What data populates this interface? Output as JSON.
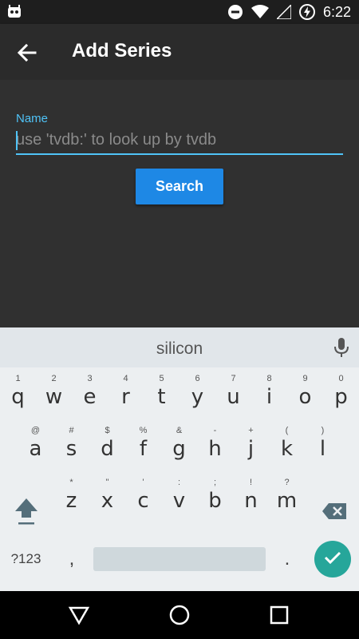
{
  "status_bar": {
    "time": "6:22",
    "icons": [
      "android-icon",
      "do-not-disturb-icon",
      "wifi-icon",
      "signal-icon",
      "battery-charging-icon"
    ]
  },
  "app_bar": {
    "title": "Add Series",
    "back_icon": "back-arrow-icon"
  },
  "form": {
    "name_label": "Name",
    "name_placeholder": "use 'tvdb:' to look up by tvdb",
    "name_value": "",
    "search_label": "Search"
  },
  "keyboard": {
    "suggestion": "silicon",
    "row1": [
      {
        "c": "q",
        "h": "1"
      },
      {
        "c": "w",
        "h": "2"
      },
      {
        "c": "e",
        "h": "3"
      },
      {
        "c": "r",
        "h": "4"
      },
      {
        "c": "t",
        "h": "5"
      },
      {
        "c": "y",
        "h": "6"
      },
      {
        "c": "u",
        "h": "7"
      },
      {
        "c": "i",
        "h": "8"
      },
      {
        "c": "o",
        "h": "9"
      },
      {
        "c": "p",
        "h": "0"
      }
    ],
    "row2": [
      {
        "c": "a",
        "h": "@"
      },
      {
        "c": "s",
        "h": "#"
      },
      {
        "c": "d",
        "h": "$"
      },
      {
        "c": "f",
        "h": "%"
      },
      {
        "c": "g",
        "h": "&"
      },
      {
        "c": "h",
        "h": "-"
      },
      {
        "c": "j",
        "h": "+"
      },
      {
        "c": "k",
        "h": "("
      },
      {
        "c": "l",
        "h": ")"
      }
    ],
    "row3": [
      {
        "c": "z",
        "h": "*"
      },
      {
        "c": "x",
        "h": "\""
      },
      {
        "c": "c",
        "h": "'"
      },
      {
        "c": "v",
        "h": ":"
      },
      {
        "c": "b",
        "h": ";"
      },
      {
        "c": "n",
        "h": "!"
      },
      {
        "c": "m",
        "h": "?"
      }
    ],
    "symbols_label": "?123",
    "comma": ",",
    "period": "."
  },
  "colors": {
    "accent": "#4fc3f7",
    "button": "#1e88e5",
    "enter": "#26a69a"
  }
}
